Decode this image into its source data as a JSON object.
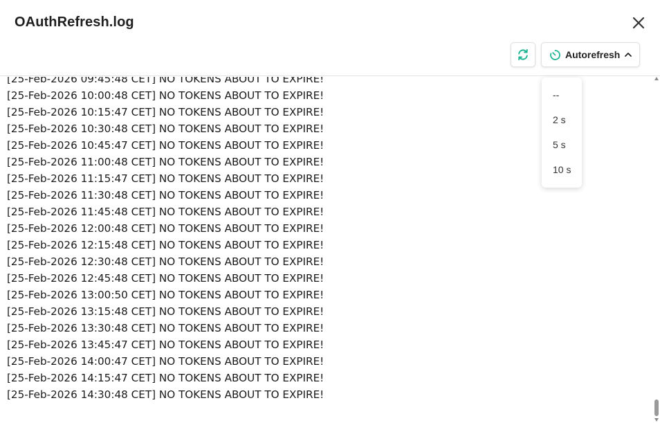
{
  "dialog": {
    "title": "OAuthRefresh.log"
  },
  "toolbar": {
    "autorefresh_label": "Autorefresh",
    "accent_color": "#1fb592"
  },
  "autorefresh_menu": {
    "options": [
      "--",
      "2 s",
      "5 s",
      "10 s"
    ]
  },
  "icons": {
    "close": "close-icon",
    "refresh": "refresh-icon",
    "timer": "timer-icon",
    "chevron": "chevron-up-icon"
  },
  "log": {
    "lines": [
      "[25-Feb-2026 09:45:48 CET] NO TOKENS ABOUT TO EXPIRE!",
      "[25-Feb-2026 10:00:48 CET] NO TOKENS ABOUT TO EXPIRE!",
      "[25-Feb-2026 10:15:47 CET] NO TOKENS ABOUT TO EXPIRE!",
      "[25-Feb-2026 10:30:48 CET] NO TOKENS ABOUT TO EXPIRE!",
      "[25-Feb-2026 10:45:47 CET] NO TOKENS ABOUT TO EXPIRE!",
      "[25-Feb-2026 11:00:48 CET] NO TOKENS ABOUT TO EXPIRE!",
      "[25-Feb-2026 11:15:47 CET] NO TOKENS ABOUT TO EXPIRE!",
      "[25-Feb-2026 11:30:48 CET] NO TOKENS ABOUT TO EXPIRE!",
      "[25-Feb-2026 11:45:48 CET] NO TOKENS ABOUT TO EXPIRE!",
      "[25-Feb-2026 12:00:48 CET] NO TOKENS ABOUT TO EXPIRE!",
      "[25-Feb-2026 12:15:48 CET] NO TOKENS ABOUT TO EXPIRE!",
      "[25-Feb-2026 12:30:48 CET] NO TOKENS ABOUT TO EXPIRE!",
      "[25-Feb-2026 12:45:48 CET] NO TOKENS ABOUT TO EXPIRE!",
      "[25-Feb-2026 13:00:50 CET] NO TOKENS ABOUT TO EXPIRE!",
      "[25-Feb-2026 13:15:48 CET] NO TOKENS ABOUT TO EXPIRE!",
      "[25-Feb-2026 13:30:48 CET] NO TOKENS ABOUT TO EXPIRE!",
      "[25-Feb-2026 13:45:47 CET] NO TOKENS ABOUT TO EXPIRE!",
      "[25-Feb-2026 14:00:47 CET] NO TOKENS ABOUT TO EXPIRE!",
      "[25-Feb-2026 14:15:47 CET] NO TOKENS ABOUT TO EXPIRE!",
      "[25-Feb-2026 14:30:48 CET] NO TOKENS ABOUT TO EXPIRE!"
    ]
  }
}
